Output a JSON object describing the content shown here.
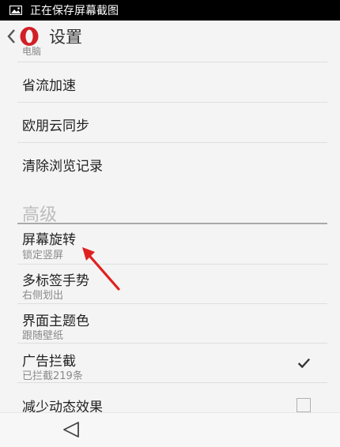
{
  "status_bar": {
    "text": "正在保存屏幕截图",
    "icon": "picture-icon"
  },
  "app_bar": {
    "title": "设置",
    "back_icon": "chevron-left-icon",
    "logo": "opera-logo"
  },
  "list": {
    "cut_off_subtitle": "电脑",
    "items_top": [
      {
        "title": "省流加速"
      },
      {
        "title": "欧朋云同步"
      },
      {
        "title": "清除浏览记录"
      }
    ],
    "section_header": "高级",
    "items_advanced": [
      {
        "title": "屏幕旋转",
        "subtitle": "锁定竖屏"
      },
      {
        "title": "多标签手势",
        "subtitle": "右侧划出"
      },
      {
        "title": "界面主题色",
        "subtitle": "跟随壁纸"
      },
      {
        "title": "广告拦截",
        "subtitle": "已拦截219条",
        "checked": true
      },
      {
        "title": "减少动态效果",
        "checked": false
      }
    ]
  },
  "colors": {
    "accent_red": "#e02020",
    "opera_red": "#d21f26"
  },
  "nav_bar": {
    "back_icon": "triangle-back-icon"
  }
}
